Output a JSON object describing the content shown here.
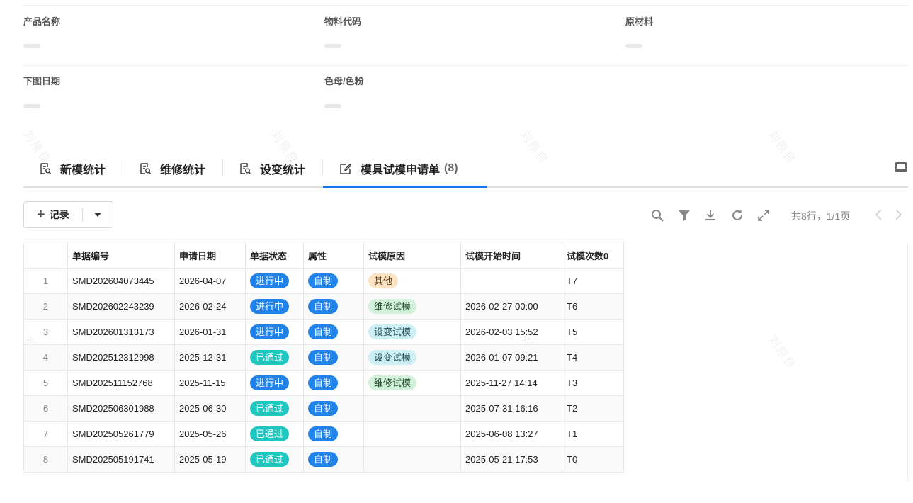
{
  "form": {
    "fields": [
      {
        "label": "产品名称"
      },
      {
        "label": "物料代码"
      },
      {
        "label": "原材料"
      },
      {
        "label": "下图日期"
      },
      {
        "label": "色母/色粉"
      }
    ]
  },
  "watermark": "刘原良",
  "tabs": [
    {
      "label": "新模统计",
      "icon": "report-search-icon"
    },
    {
      "label": "维修统计",
      "icon": "report-search-icon"
    },
    {
      "label": "设变统计",
      "icon": "report-search-icon"
    },
    {
      "label": "模具试模申请单",
      "icon": "edit-icon",
      "count": "(8)",
      "active": true
    }
  ],
  "toolbar": {
    "add_label": "记录",
    "icons": [
      "search-icon",
      "filter-icon",
      "download-icon",
      "refresh-icon",
      "fullscreen-icon"
    ],
    "pager_text": "共8行，1/1页"
  },
  "table": {
    "columns": [
      "",
      "单据编号",
      "申请日期",
      "单据状态",
      "属性",
      "试模原因",
      "试模开始时间",
      "试模次数0"
    ],
    "rows": [
      {
        "idx": "1",
        "code": "SMD202604073445",
        "date": "2026-04-07",
        "status": "进行中",
        "attr": "自制",
        "reason": "其他",
        "start": "",
        "times": "T7"
      },
      {
        "idx": "2",
        "code": "SMD202602243239",
        "date": "2026-02-24",
        "status": "进行中",
        "attr": "自制",
        "reason": "维修试模",
        "start": "2026-02-27 00:00",
        "times": "T6"
      },
      {
        "idx": "3",
        "code": "SMD202601313173",
        "date": "2026-01-31",
        "status": "进行中",
        "attr": "自制",
        "reason": "设变试模",
        "start": "2026-02-03 15:52",
        "times": "T5"
      },
      {
        "idx": "4",
        "code": "SMD202512312998",
        "date": "2025-12-31",
        "status": "已通过",
        "attr": "自制",
        "reason": "设变试模",
        "start": "2026-01-07 09:21",
        "times": "T4"
      },
      {
        "idx": "5",
        "code": "SMD202511152768",
        "date": "2025-11-15",
        "status": "进行中",
        "attr": "自制",
        "reason": "维修试模",
        "start": "2025-11-27 14:14",
        "times": "T3"
      },
      {
        "idx": "6",
        "code": "SMD202506301988",
        "date": "2025-06-30",
        "status": "已通过",
        "attr": "自制",
        "reason": "",
        "start": "2025-07-31 16:16",
        "times": "T2"
      },
      {
        "idx": "7",
        "code": "SMD202505261779",
        "date": "2025-05-26",
        "status": "已通过",
        "attr": "自制",
        "reason": "",
        "start": "2025-06-08 13:27",
        "times": "T1"
      },
      {
        "idx": "8",
        "code": "SMD202505191741",
        "date": "2025-05-19",
        "status": "已通过",
        "attr": "自制",
        "reason": "",
        "start": "2025-05-21 17:53",
        "times": "T0"
      }
    ]
  },
  "colors": {
    "accent": "#1a73e8",
    "status_in_progress": "#2183e9",
    "status_passed": "#1fc7c1",
    "reason_other": "#fde3c4",
    "reason_repair": "#d2f0da",
    "reason_change": "#cdeff4"
  }
}
